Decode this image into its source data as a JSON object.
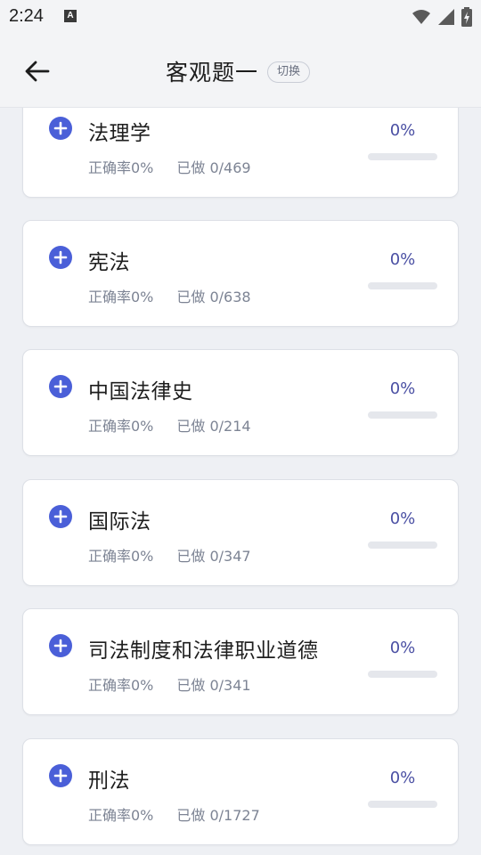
{
  "status": {
    "time": "2:24",
    "a_badge": "A"
  },
  "header": {
    "title": "客观题一",
    "switch_label": "切换"
  },
  "items": [
    {
      "title": "法理学",
      "accuracy": "正确率0%",
      "done": "已做 0/469",
      "percent": "0%",
      "progress": 0
    },
    {
      "title": "宪法",
      "accuracy": "正确率0%",
      "done": "已做 0/638",
      "percent": "0%",
      "progress": 0
    },
    {
      "title": "中国法律史",
      "accuracy": "正确率0%",
      "done": "已做 0/214",
      "percent": "0%",
      "progress": 0
    },
    {
      "title": "国际法",
      "accuracy": "正确率0%",
      "done": "已做 0/347",
      "percent": "0%",
      "progress": 0
    },
    {
      "title": "司法制度和法律职业道德",
      "accuracy": "正确率0%",
      "done": "已做 0/341",
      "percent": "0%",
      "progress": 0
    },
    {
      "title": "刑法",
      "accuracy": "正确率0%",
      "done": "已做 0/1727",
      "percent": "0%",
      "progress": 0
    }
  ],
  "colors": {
    "accent": "#4a5fd8",
    "percent_text": "#4a4fa3"
  }
}
